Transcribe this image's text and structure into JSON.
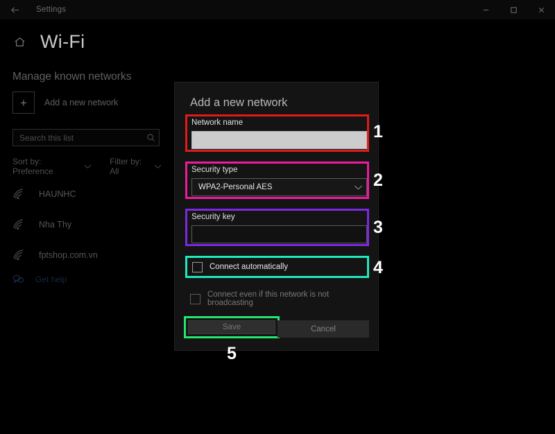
{
  "titlebar": {
    "back_icon": "back-arrow-icon",
    "title": "Settings",
    "minimize": "–",
    "maximize": "□",
    "close": "×"
  },
  "header": {
    "home_icon": "home-icon",
    "title": "Wi-Fi"
  },
  "left_panel": {
    "subtitle": "Manage known networks",
    "add_network": {
      "plus": "+",
      "label": "Add a new network"
    },
    "search": {
      "placeholder": "Search this list",
      "icon": "search-icon"
    },
    "sort": {
      "label": "Sort by: Preference",
      "chevron": "⌄"
    },
    "filter": {
      "label": "Filter by: All",
      "chevron": "⌄"
    },
    "networks": [
      {
        "name": "HAUNHC",
        "icon": "wifi-icon"
      },
      {
        "name": "Nha Thy",
        "icon": "wifi-icon"
      },
      {
        "name": "fptshop.com.vn",
        "icon": "wifi-icon"
      }
    ],
    "get_help": {
      "icon": "chat-bubble-icon",
      "label": "Get help"
    }
  },
  "dialog": {
    "title": "Add a new network",
    "network_name": {
      "label": "Network name",
      "value": "",
      "placeholder": ""
    },
    "security_type": {
      "label": "Security type",
      "value": "WPA2-Personal AES",
      "chevron": "⌄",
      "options": [
        "WPA2-Personal AES"
      ]
    },
    "security_key": {
      "label": "Security key",
      "value": "",
      "placeholder": ""
    },
    "connect_automatically": {
      "label": "Connect automatically",
      "checked": false
    },
    "connect_not_broadcasting": {
      "label": "Connect even if this network is not broadcasting",
      "checked": false
    },
    "save_button": "Save",
    "cancel_button": "Cancel"
  },
  "annotations": {
    "colors": {
      "one": "#e01b1b",
      "two": "#ef1a9e",
      "three": "#7d28e2",
      "four": "#22e8bd",
      "five": "#22e86f"
    },
    "numbers": {
      "one": "1",
      "two": "2",
      "three": "3",
      "four": "4",
      "five": "5"
    }
  }
}
